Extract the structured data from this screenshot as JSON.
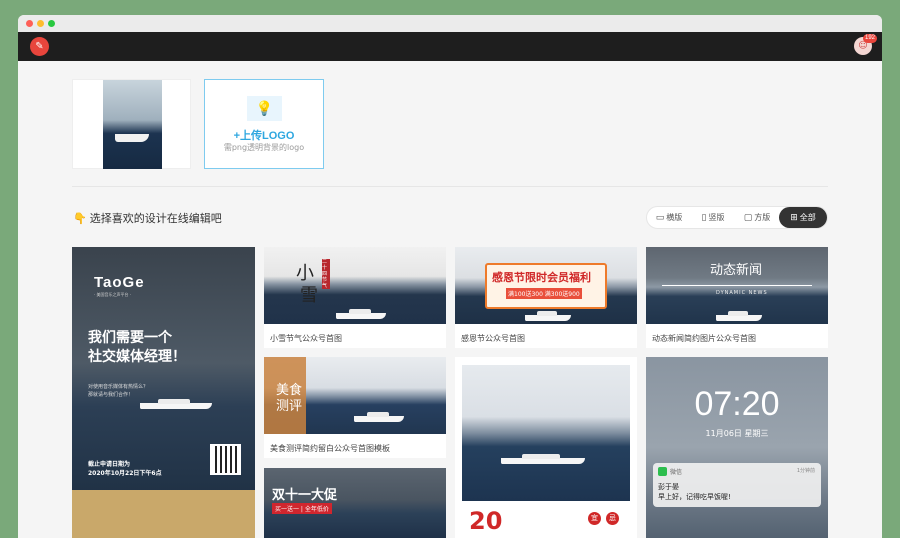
{
  "header": {
    "notification_count": "192"
  },
  "upload": {
    "title": "+上传LOGO",
    "hint": "需png透明背景的logo"
  },
  "section": {
    "title": "选择喜欢的设计在线编辑吧"
  },
  "filters": [
    {
      "label": "横版",
      "icon": "landscape-icon"
    },
    {
      "label": "竖版",
      "icon": "portrait-icon"
    },
    {
      "label": "方版",
      "icon": "square-icon"
    },
    {
      "label": "全部",
      "icon": "grid-icon"
    }
  ],
  "templates": {
    "poster": {
      "brand": "TaoGe",
      "brand_sub": "· 美国音乐之声平台 ·",
      "headline1": "我们需要一个",
      "headline2": "社交媒体经理！",
      "sub1": "对使用音乐媒体有热情么？",
      "sub2": "那就请与我们合作！",
      "deadline1": "截止申请日期为",
      "deadline2": "2020年10月22日下午6点"
    },
    "xiaoxue": {
      "caption": "小雪节气公众号首图",
      "big1": "小",
      "big2": "雪",
      "tag": "二十四节气"
    },
    "ganen": {
      "caption": "感恩节公众号首图",
      "title": "感恩节限时会员福利",
      "offer": "满100送300 满300送900"
    },
    "news": {
      "caption": "动态新闻简约图片公众号首图",
      "title": "动态新闻",
      "subtitle": "DYNAMIC NEWS"
    },
    "food": {
      "caption": "美食测评简约留白公众号首图模板",
      "line1": "美食",
      "line2": "测评"
    },
    "double11": {
      "title": "双十一大促",
      "sub": "买一送一 | 全年低价"
    },
    "wechat": {
      "time": "07:20",
      "date": "11月06日 星期三",
      "app": "微信",
      "ago": "1分钟前",
      "sender": "彭于晏",
      "message": "早上好，记得吃早饭喔!"
    },
    "sea_card": {
      "number": "20",
      "stamp1": "宜",
      "stamp2": "忌"
    }
  }
}
